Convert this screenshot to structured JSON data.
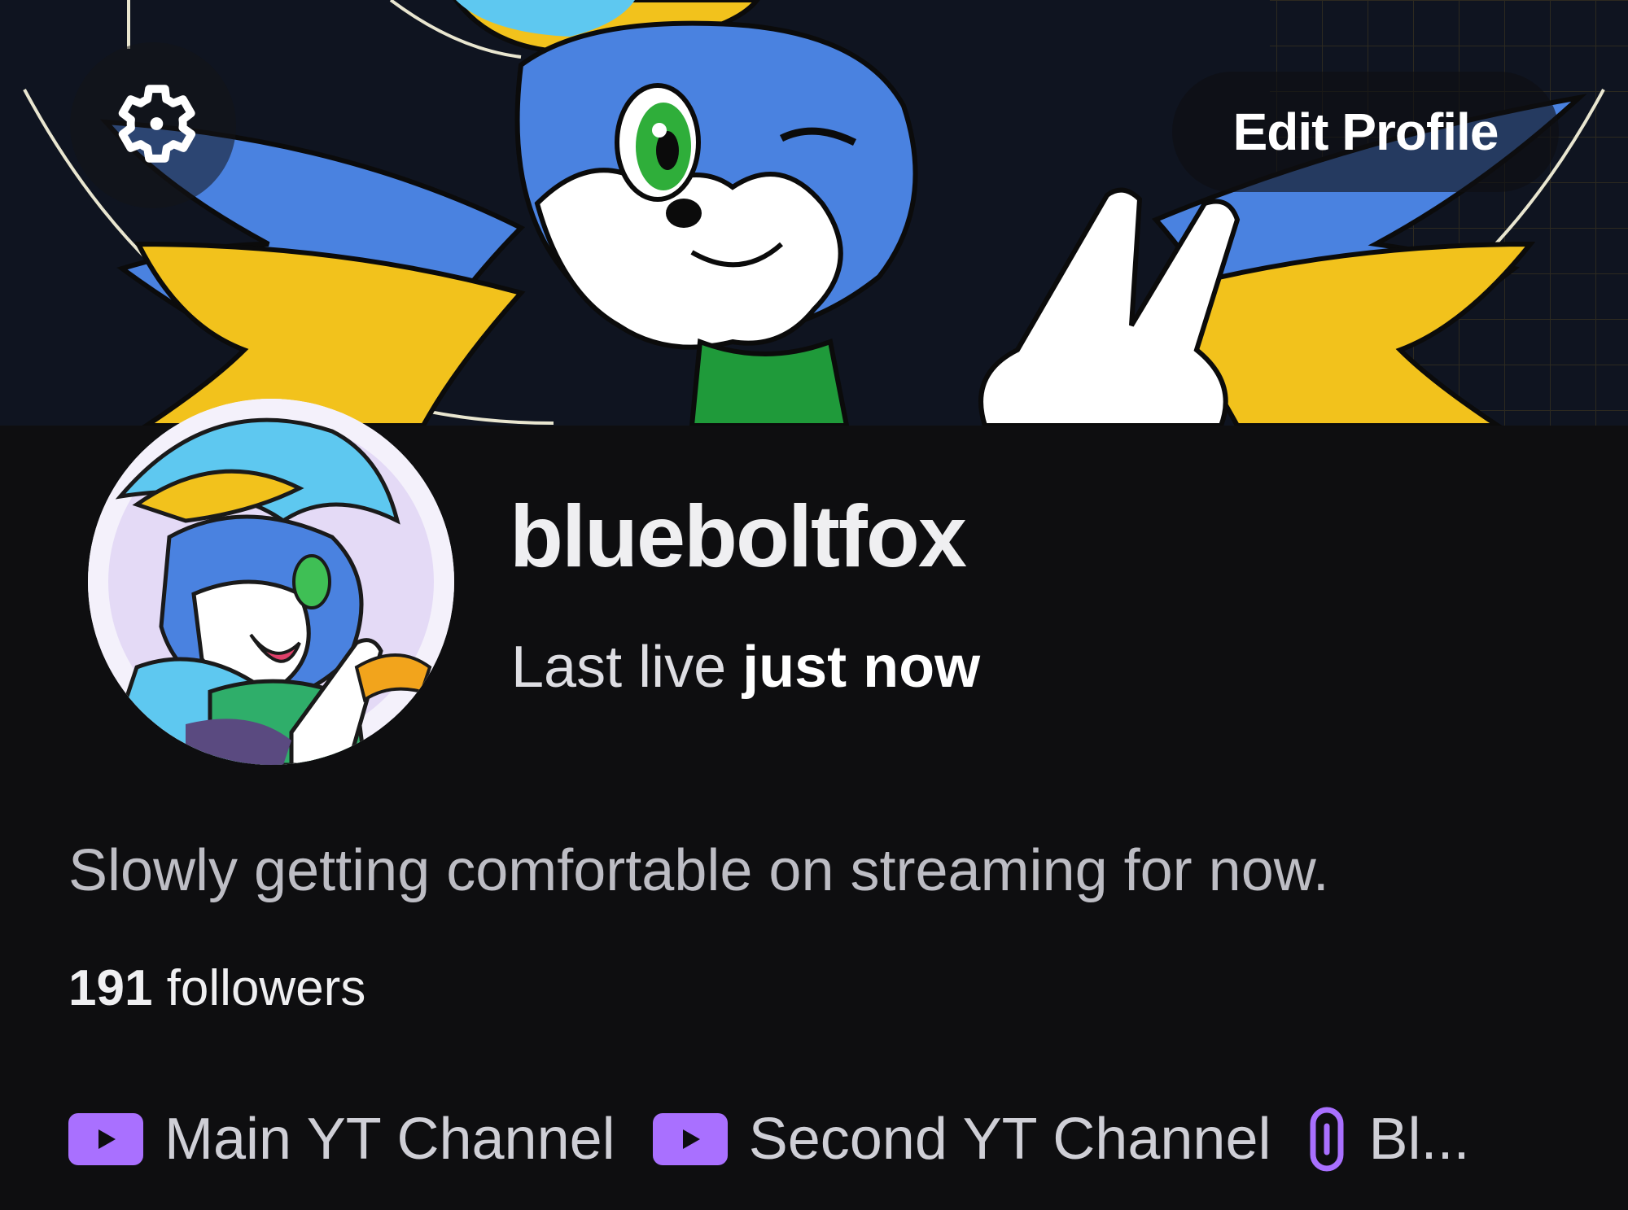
{
  "header": {
    "settings_icon": "gear-icon",
    "edit_profile_label": "Edit Profile"
  },
  "profile": {
    "username": "blueboltfox",
    "last_live_prefix": "Last live",
    "last_live_value": "just now",
    "bio": "Slowly getting comfortable on streaming for now.",
    "followers_count": "191",
    "followers_label": "followers"
  },
  "links": [
    {
      "icon": "youtube-icon",
      "label": "Main YT Channel"
    },
    {
      "icon": "youtube-icon",
      "label": "Second YT Channel"
    },
    {
      "icon": "link-icon",
      "label": "Bl..."
    }
  ],
  "colors": {
    "background": "#0e0e10",
    "accent_purple": "#a970ff",
    "text_primary": "#efeff1"
  }
}
